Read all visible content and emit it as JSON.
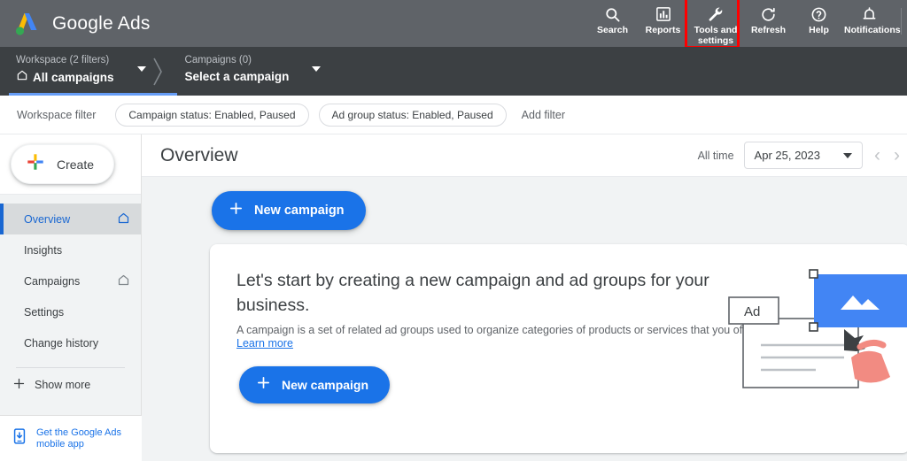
{
  "brand": {
    "name": "Google Ads",
    "logo_icon": "google-ads-logo"
  },
  "topbar": {
    "actions": [
      {
        "label": "Search",
        "icon": "search-icon"
      },
      {
        "label": "Reports",
        "icon": "reports-bar-chart-icon"
      },
      {
        "label": "Tools and settings",
        "icon": "wrench-tools-icon",
        "highlighted": true
      },
      {
        "label": "Refresh",
        "icon": "refresh-icon"
      },
      {
        "label": "Help",
        "icon": "help-question-icon"
      },
      {
        "label": "Notifications",
        "icon": "bell-icon"
      }
    ],
    "highlight_color": "#ff0000"
  },
  "breadcrumb": {
    "workspace": {
      "sub": "Workspace (2 filters)",
      "main": "All campaigns",
      "icon": "home-icon"
    },
    "campaign": {
      "sub": "Campaigns (0)",
      "main": "Select a campaign"
    },
    "active_indicator_color": "#669df6"
  },
  "filterbar": {
    "label": "Workspace filter",
    "chips": [
      "Campaign status: Enabled, Paused",
      "Ad group status: Enabled, Paused"
    ],
    "add_filter": "Add filter"
  },
  "sidebar": {
    "create_label": "Create",
    "items": [
      {
        "label": "Overview",
        "icon": "home-icon",
        "active": true
      },
      {
        "label": "Insights",
        "icon": "",
        "active": false
      },
      {
        "label": "Campaigns",
        "icon": "home-icon",
        "active": false
      },
      {
        "label": "Settings",
        "icon": "",
        "active": false
      },
      {
        "label": "Change history",
        "icon": "",
        "active": false
      }
    ],
    "show_more": "Show more",
    "mobile_app": "Get the Google Ads mobile app",
    "accent_color": "#1967d2"
  },
  "page": {
    "title": "Overview",
    "date_range_label": "All time",
    "date_value": "Apr 25, 2023",
    "prev_icon": "chevron-left-icon",
    "next_icon": "chevron-right-icon"
  },
  "main": {
    "new_campaign_top": "New campaign",
    "card": {
      "heading": "Let's start by creating a new campaign and ad groups for your business.",
      "body": "A campaign is a set of related ad groups used to organize categories of products or services that you offer.",
      "link": "Learn more",
      "button": "New campaign",
      "illustration_ad_label": "Ad"
    },
    "accent_color": "#1a73e8"
  }
}
